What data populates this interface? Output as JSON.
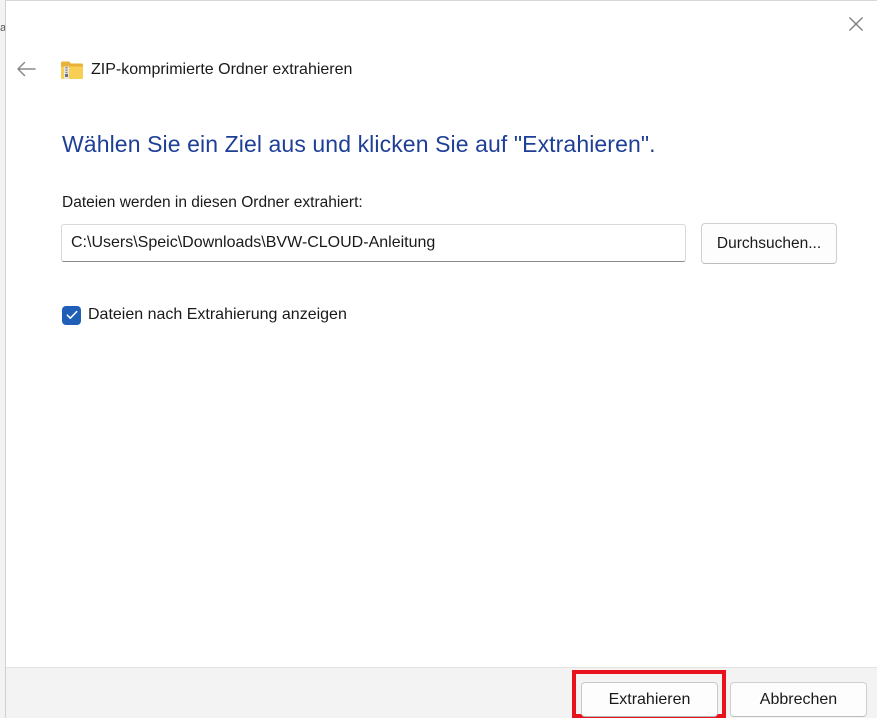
{
  "window": {
    "title": "ZIP-komprimierte Ordner extrahieren",
    "close_icon": "close-icon",
    "back_icon": "arrow-left-icon",
    "title_icon": "zip-folder-icon"
  },
  "main": {
    "heading": "Wählen Sie ein Ziel aus und klicken Sie auf \"Extrahieren\".",
    "folder_label": "Dateien werden in diesen Ordner extrahiert:",
    "path_value": "C:\\Users\\Speic\\Downloads\\BVW-CLOUD-Anleitung",
    "browse_label": "Durchsuchen...",
    "show_files_label": "Dateien nach Extrahierung anzeigen",
    "show_files_checked": true
  },
  "footer": {
    "extract_label": "Extrahieren",
    "cancel_label": "Abbrechen"
  },
  "colors": {
    "heading": "#1e3f96",
    "checkbox": "#1f5fb8",
    "highlight": "#e8121c"
  }
}
